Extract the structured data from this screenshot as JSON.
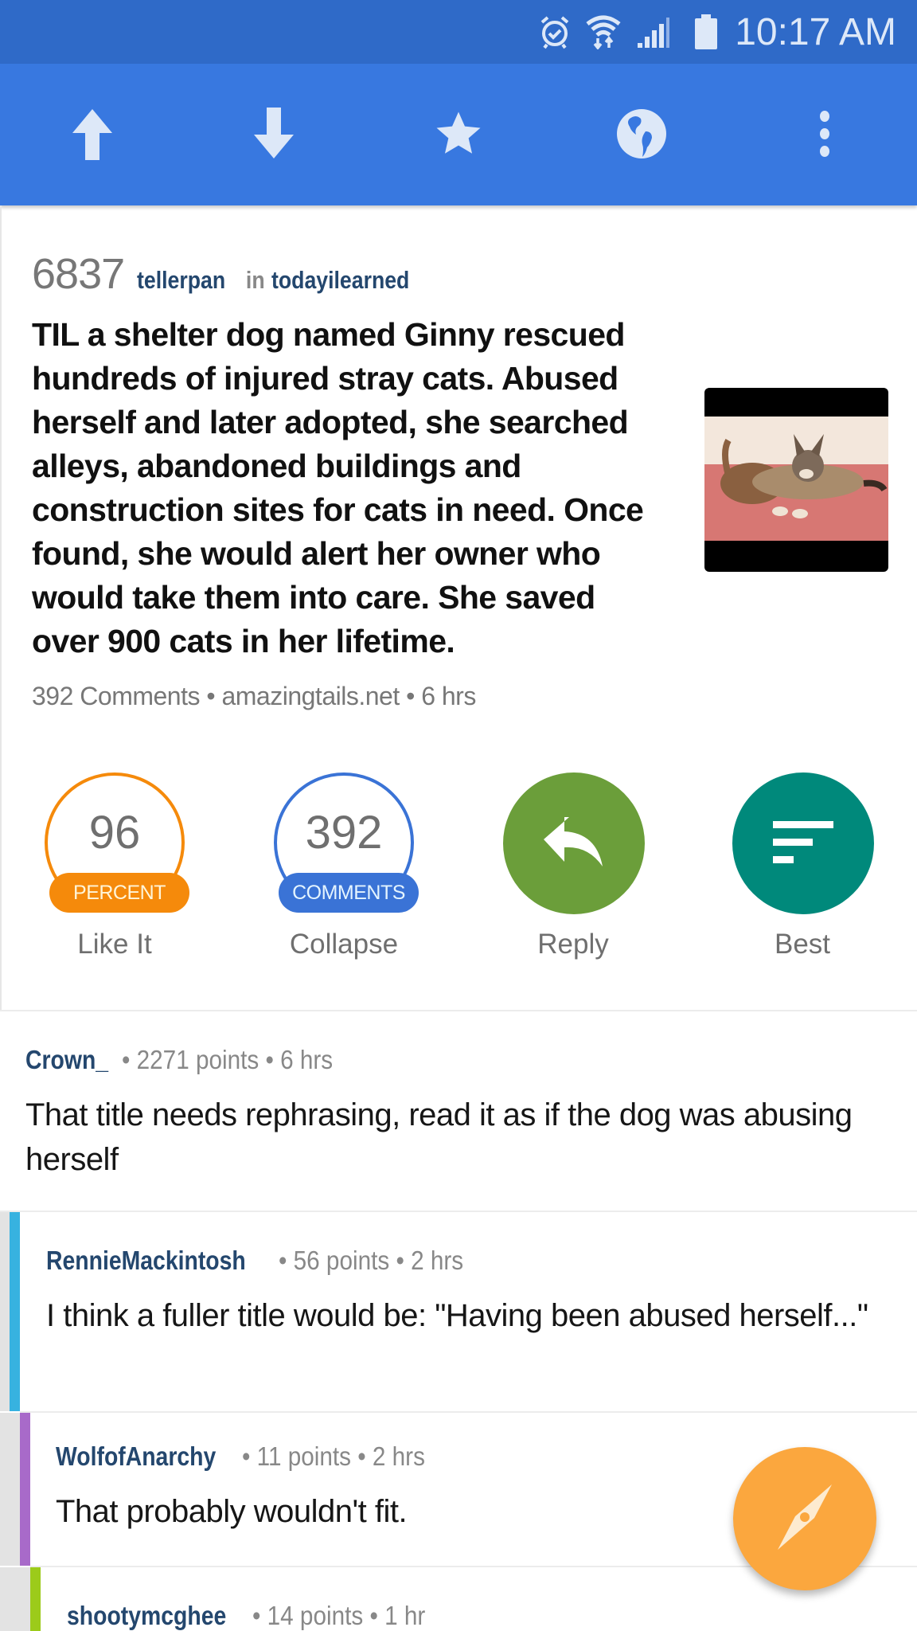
{
  "status_bar": {
    "time": "10:17 AM",
    "icons": [
      "alarm-icon",
      "wifi-icon",
      "signal-icon",
      "battery-icon"
    ]
  },
  "toolbar": {
    "buttons": [
      {
        "name": "upvote",
        "icon": "arrow-up-icon"
      },
      {
        "name": "downvote",
        "icon": "arrow-down-icon"
      },
      {
        "name": "save",
        "icon": "star-icon"
      },
      {
        "name": "open-in-browser",
        "icon": "globe-icon"
      },
      {
        "name": "more",
        "icon": "more-vertical-icon"
      }
    ]
  },
  "colors": {
    "status_bar": "#2f6ac8",
    "toolbar": "#3878e0",
    "author": "#24476e",
    "orange": "#f58a0b",
    "blue": "#3a73d6",
    "green": "#6b9e3a",
    "teal": "#00897b",
    "fab": "#fba73e",
    "depth1": "#37b2e0",
    "depth2": "#a86ac9",
    "depth3": "#9ccb1a"
  },
  "post": {
    "score": "6837",
    "author": "tellerpan",
    "in_word": "in",
    "subreddit": "todayilearned",
    "title": "TIL a shelter dog named Ginny rescued hundreds of injured stray cats. Abused herself and later adopted, she searched alleys, abandoned buildings and construction sites for cats in need. Once found, she would alert her owner who would take them into care. She saved over 900 cats in her lifetime.",
    "info": "392 Comments • amazingtails.net • 6 hrs",
    "thumbnail_alt": "Dog and cat lying together on a pink blanket"
  },
  "actions": [
    {
      "value": "96",
      "pill": "PERCENT",
      "label": "Like It"
    },
    {
      "value": "392",
      "pill": "COMMENTS",
      "label": "Collapse"
    },
    {
      "icon": "reply-icon",
      "label": "Reply"
    },
    {
      "icon": "sort-icon",
      "label": "Best"
    }
  ],
  "comments": [
    {
      "author": "Crown_",
      "meta": " • 2271 points • 6 hrs",
      "body": "That title needs rephrasing, read it as if the dog was abusing herself",
      "depth": 0
    },
    {
      "author": "RennieMackintosh",
      "meta": " • 56 points • 2 hrs",
      "body": "I think a fuller title would be: \"Having been abused herself...\"",
      "depth": 1
    },
    {
      "author": "WolfofAnarchy",
      "meta": " • 11 points • 2 hrs",
      "body": "That probably wouldn't fit.",
      "depth": 2
    },
    {
      "author": "shootymcghee",
      "meta": " • 14 points • 1 hr",
      "body": "",
      "depth": 3
    }
  ],
  "fab": {
    "icon": "compass-icon"
  }
}
